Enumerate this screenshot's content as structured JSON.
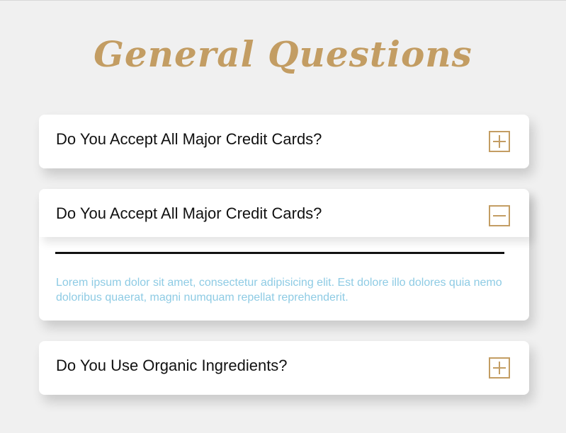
{
  "page": {
    "title": "General Questions"
  },
  "faqs": [
    {
      "question": "Do You Accept All Major Credit Cards?",
      "expanded": false,
      "toggle_icon": "plus-icon"
    },
    {
      "question": "Do You Accept All Major Credit Cards?",
      "expanded": true,
      "toggle_icon": "minus-icon",
      "answer": "Lorem ipsum dolor sit amet, consectetur adipisicing elit. Est dolore illo dolores quia nemo doloribus quaerat, magni numquam repellat reprehenderit."
    },
    {
      "question": "Do You Use Organic Ingredients?",
      "expanded": false,
      "toggle_icon": "plus-icon"
    }
  ],
  "colors": {
    "accent": "#c39d63",
    "answer_text": "#8ecbe4",
    "background": "#f0f0f0",
    "card": "#ffffff"
  }
}
